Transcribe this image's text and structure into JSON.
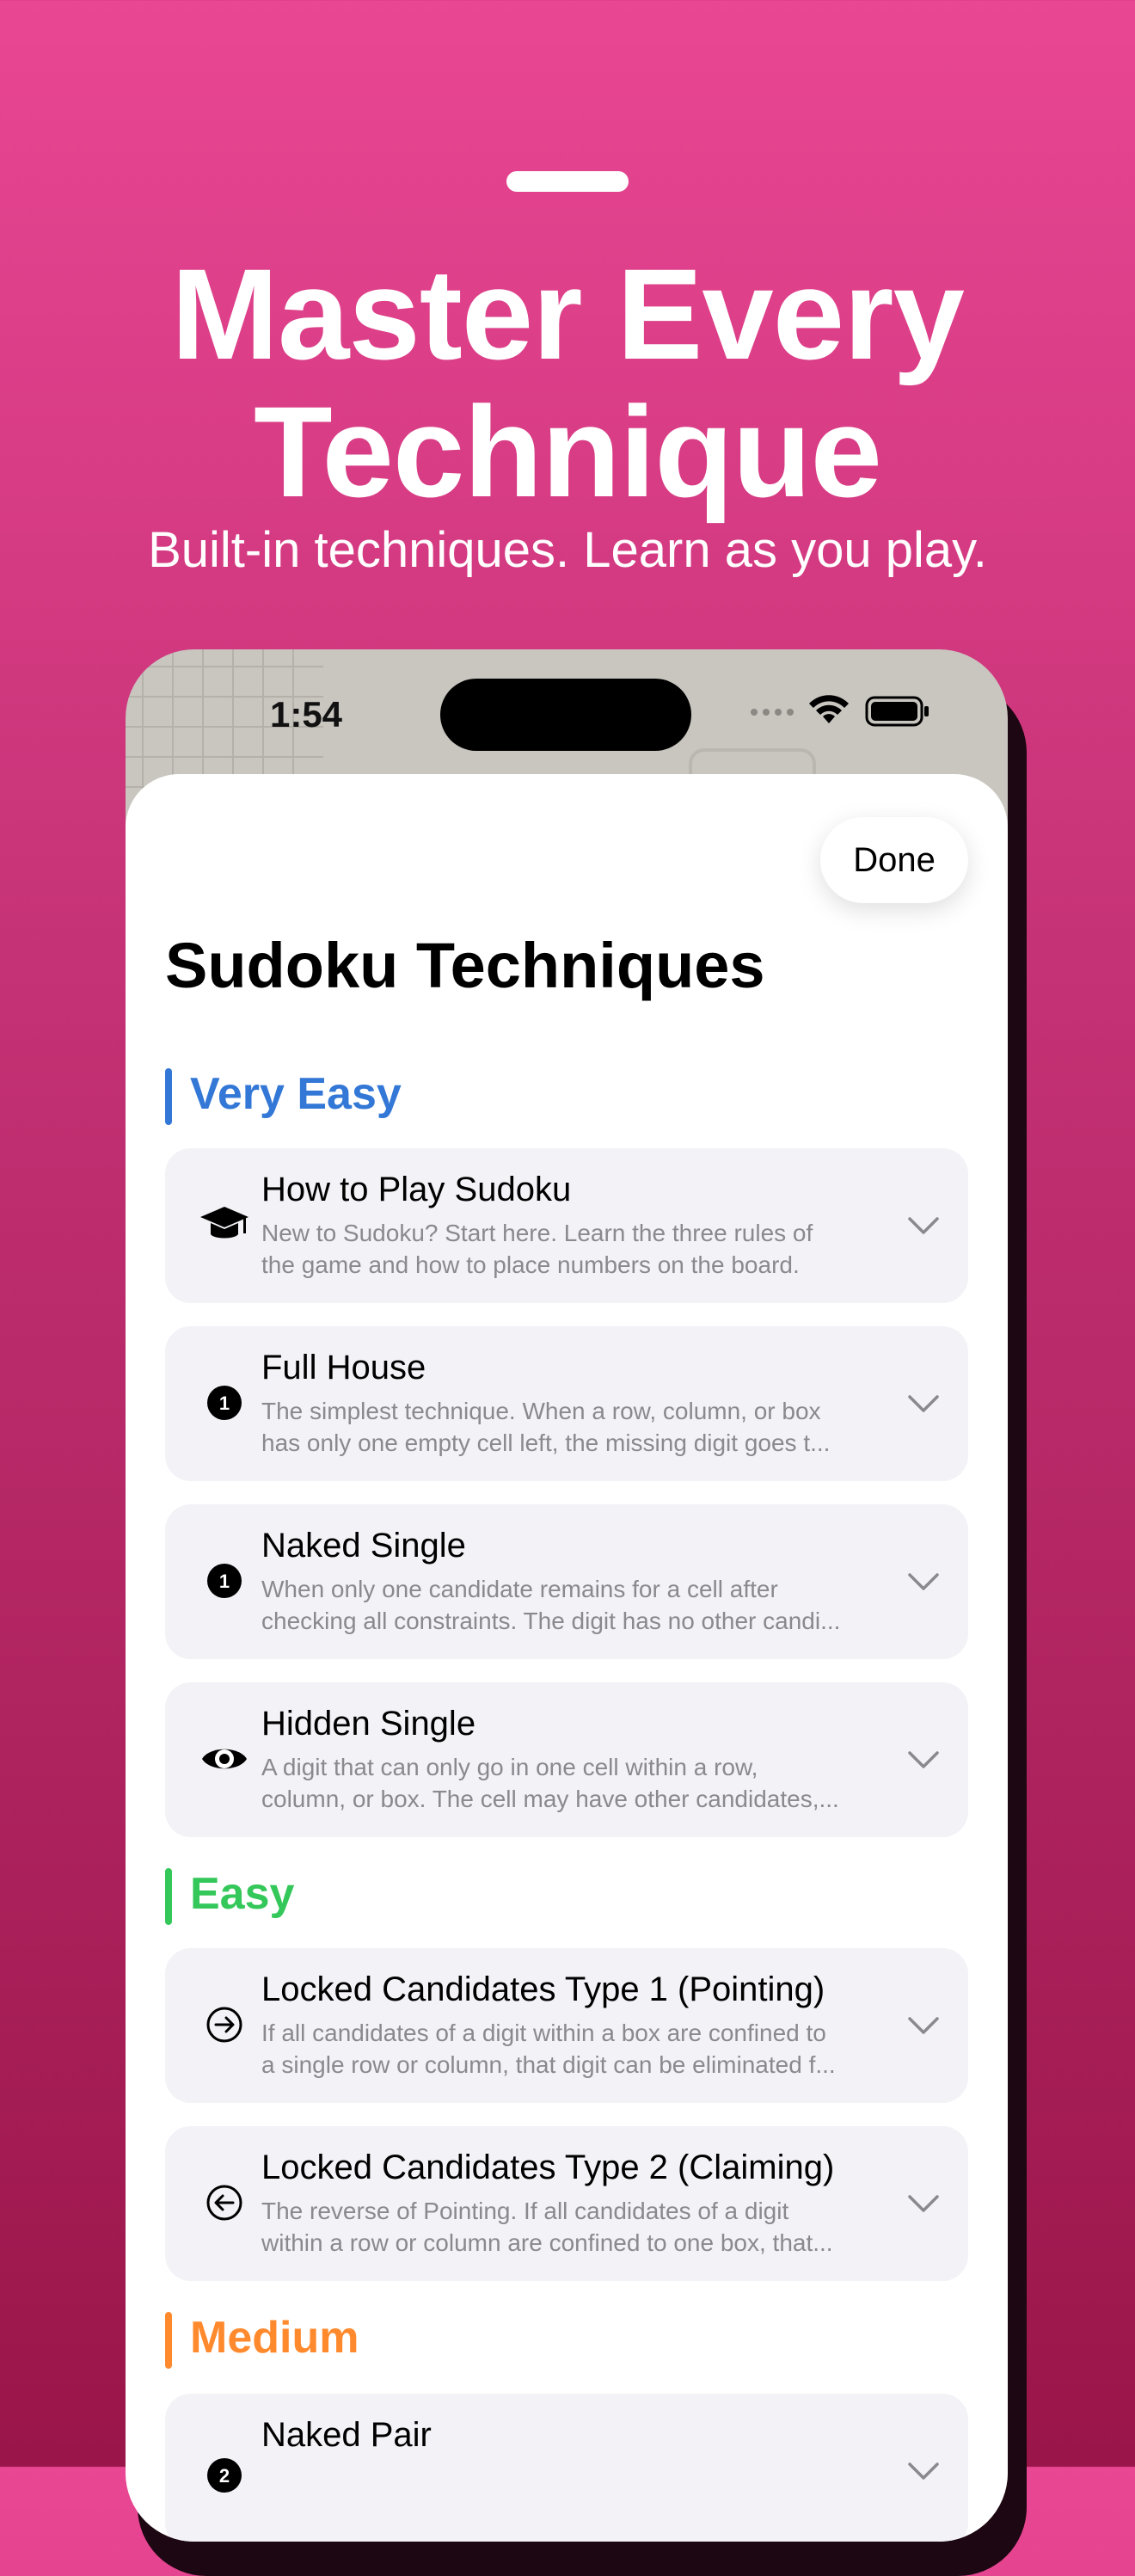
{
  "header": {
    "headline_line1": "Master Every",
    "headline_line2": "Technique",
    "subtitle": "Built-in techniques. Learn as you play."
  },
  "status_bar": {
    "time": "1:54",
    "icons": [
      "cellular-dots-icon",
      "wifi-icon",
      "battery-icon"
    ]
  },
  "sheet": {
    "done_label": "Done",
    "title": "Sudoku Techniques"
  },
  "colors": {
    "very_easy": "#3378d6",
    "easy": "#34c759",
    "medium": "#ff8a2e",
    "background_top": "#e94693",
    "background_bottom": "#9a1549"
  },
  "sections": [
    {
      "label": "Very Easy",
      "items": [
        {
          "icon": "graduation-cap-icon",
          "title": "How to Play Sudoku",
          "desc1": "New to Sudoku? Start here. Learn the three rules of",
          "desc2": "the game and how to place numbers on the board."
        },
        {
          "icon": "number-one-circle-icon",
          "title": "Full House",
          "desc1": "The simplest technique. When a row, column, or box",
          "desc2": "has only one empty cell left, the missing digit goes t..."
        },
        {
          "icon": "number-one-circle-icon",
          "title": "Naked Single",
          "desc1": "When only one candidate remains for a cell after",
          "desc2": "checking all constraints. The digit has no other candi..."
        },
        {
          "icon": "eye-icon",
          "title": "Hidden Single",
          "desc1": "A digit that can only go in one cell within a row,",
          "desc2": "column, or box. The cell may have other candidates,..."
        }
      ]
    },
    {
      "label": "Easy",
      "items": [
        {
          "icon": "arrow-right-circle-icon",
          "title": "Locked Candidates Type 1 (Pointing)",
          "desc1": "If all candidates of a digit within a box are confined to",
          "desc2": "a single row or column, that digit can be eliminated f..."
        },
        {
          "icon": "arrow-left-circle-icon",
          "title": "Locked Candidates Type 2 (Claiming)",
          "desc1": "The reverse of Pointing. If all candidates of a digit",
          "desc2": "within a row or column are confined to one box, that..."
        }
      ]
    },
    {
      "label": "Medium",
      "items": [
        {
          "icon": "number-two-circle-icon",
          "title": "Naked Pair",
          "desc1": "",
          "desc2": ""
        }
      ]
    }
  ]
}
